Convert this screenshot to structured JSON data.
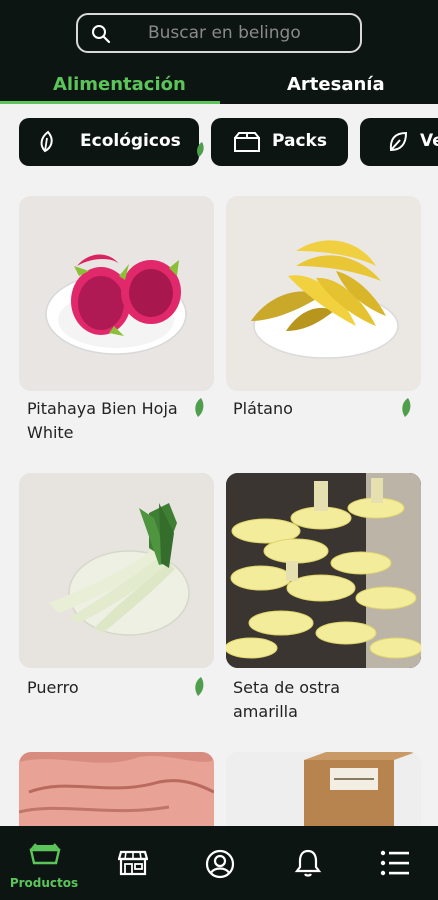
{
  "search": {
    "placeholder": "Buscar en belingo",
    "icon": "search-icon"
  },
  "tabs": [
    {
      "label": "Alimentación",
      "active": true
    },
    {
      "label": "Artesanía",
      "active": false
    }
  ],
  "chips": [
    {
      "label": "Ecológicos",
      "icon": "leaf-icon"
    },
    {
      "label": "Packs",
      "icon": "box-icon"
    },
    {
      "label": "Ve",
      "icon": "vegan-leaf-icon"
    }
  ],
  "products": [
    {
      "name": "Pitahaya Bien Hoja White",
      "line1": "Pitahaya Bien Hoja",
      "line2": "White",
      "eco": true,
      "image": "dragon-fruit-image"
    },
    {
      "name": "Plátano",
      "line1": "Plátano",
      "line2": "",
      "eco": true,
      "image": "banana-image"
    },
    {
      "name": "Puerro",
      "line1": "Puerro",
      "line2": "",
      "eco": true,
      "image": "leek-image"
    },
    {
      "name": "Seta de ostra amarilla",
      "line1": "Seta de ostra",
      "line2": "amarilla",
      "eco": false,
      "image": "yellow-oyster-mushroom-image"
    },
    {
      "name": "",
      "image": "pink-oyster-mushroom-image"
    },
    {
      "name": "",
      "image": "box-product-image"
    }
  ],
  "bottom_nav": [
    {
      "label": "Productos",
      "icon": "basket-icon",
      "active": true
    },
    {
      "label": "",
      "icon": "store-icon"
    },
    {
      "label": "",
      "icon": "user-icon"
    },
    {
      "label": "",
      "icon": "bell-icon"
    },
    {
      "label": "",
      "icon": "menu-icon"
    }
  ],
  "colors": {
    "accent": "#5bc55b",
    "dark": "#0d1512",
    "background": "#f2f2f2"
  }
}
